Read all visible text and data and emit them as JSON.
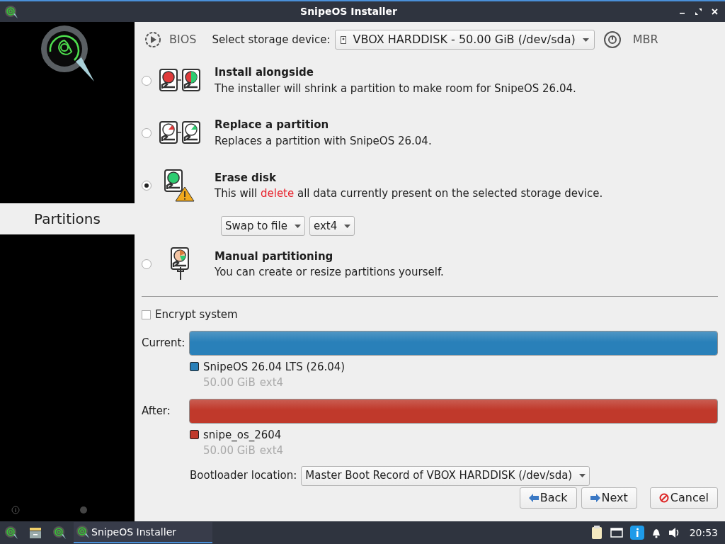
{
  "window": {
    "title": "SnipeOS Installer"
  },
  "sidebar": {
    "steps": [
      {
        "label": "Partitions",
        "selected": true
      }
    ]
  },
  "device_bar": {
    "firmware": "BIOS",
    "storage_label": "Select storage device:",
    "storage_device": "VBOX HARDDISK - 50.00 GiB (/dev/sda)",
    "partition_table": "MBR"
  },
  "options": [
    {
      "kind": "alongside",
      "title": "Install alongside",
      "selected": false,
      "description": [
        {
          "text": "The installer will shrink a partition to make room for SnipeOS 26.04.",
          "warning": false
        }
      ]
    },
    {
      "kind": "replace",
      "title": "Replace a partition",
      "selected": false,
      "description": [
        {
          "text": "Replaces a partition with SnipeOS 26.04.",
          "warning": false
        }
      ]
    },
    {
      "kind": "erase",
      "title": "Erase disk",
      "selected": true,
      "description": [
        {
          "text": "This will ",
          "warning": false
        },
        {
          "text": "delete",
          "warning": true
        },
        {
          "text": " all data currently present on the selected storage device.",
          "warning": false
        }
      ],
      "dropdowns": [
        "Swap to file",
        "ext4"
      ]
    },
    {
      "kind": "manual",
      "title": "Manual partitioning",
      "selected": false,
      "description": [
        {
          "text": "You can create or resize partitions yourself.",
          "warning": false
        }
      ]
    }
  ],
  "encrypt": {
    "label": "Encrypt system",
    "checked": false
  },
  "layouts": [
    {
      "label": "Current:",
      "partitions": [
        {
          "name": "SnipeOS 26.04 LTS (26.04)",
          "size": "50.00 GiB",
          "filesystem": "ext4",
          "color": "#2980b9"
        }
      ]
    },
    {
      "label": "After:",
      "partitions": [
        {
          "name": "snipe_os_2604",
          "size": "50.00 GiB",
          "filesystem": "ext4",
          "color": "#c0392b"
        }
      ]
    }
  ],
  "bootloader": {
    "label": "Bootloader location:",
    "value": "Master Boot Record of VBOX HARDDISK (/dev/sda)"
  },
  "buttons": [
    {
      "kind": "back",
      "label": "Back"
    },
    {
      "kind": "next",
      "label": "Next"
    },
    {
      "kind": "cancel",
      "label": "Cancel"
    }
  ],
  "taskbar": {
    "task": "SnipeOS Installer",
    "clock": "20:53"
  }
}
